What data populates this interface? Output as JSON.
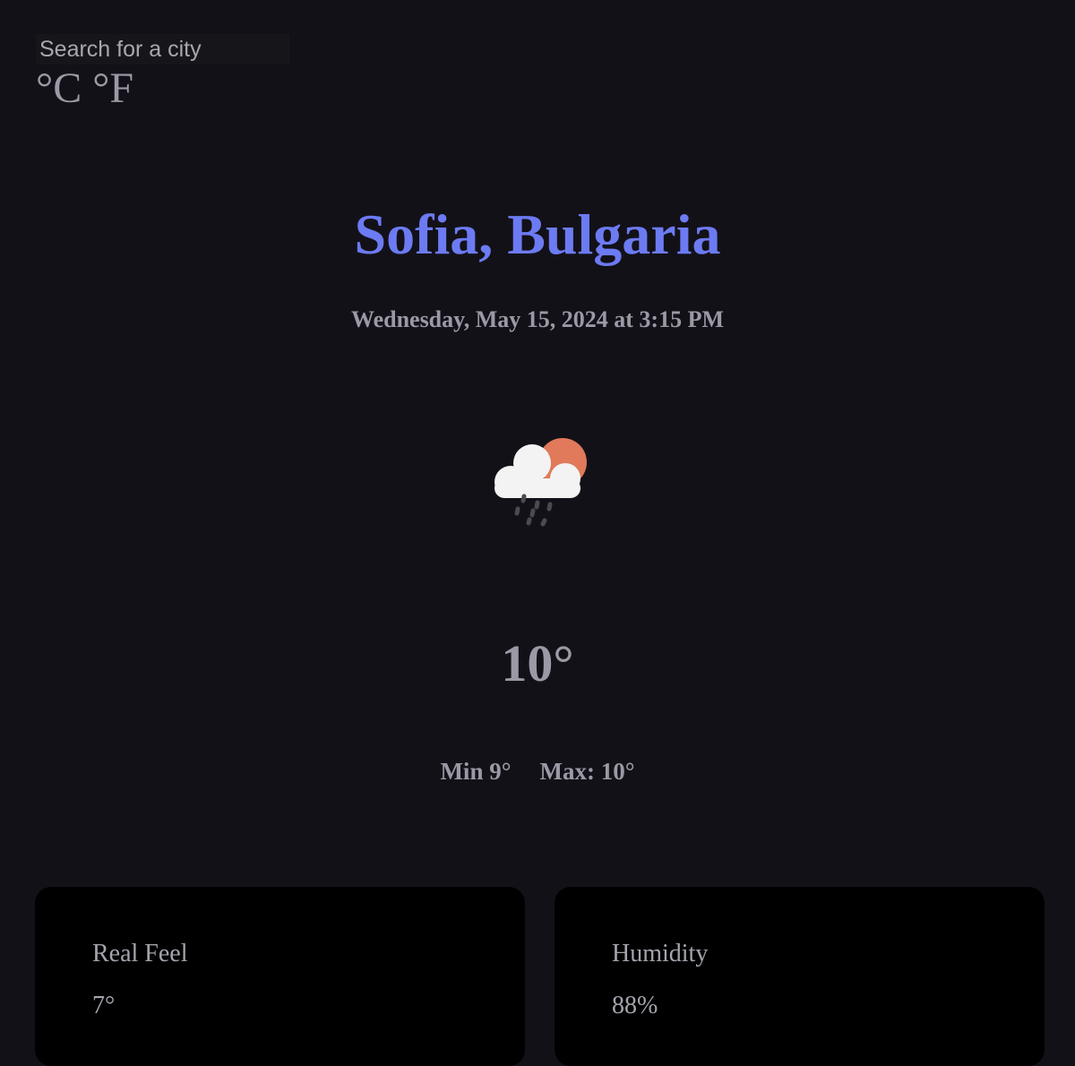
{
  "search": {
    "placeholder": "Search for a city",
    "value": ""
  },
  "units": {
    "celsius_label": "°C",
    "fahrenheit_label": "°F"
  },
  "location": {
    "title": "Sofia, Bulgaria"
  },
  "datetime": "Wednesday, May 15, 2024 at 3:15 PM",
  "weather": {
    "icon": "cloud-sun-rain-icon",
    "temperature": "10°",
    "min": "Min 9°",
    "max": "Max: 10°"
  },
  "cards": [
    {
      "label": "Real Feel",
      "value": "7°"
    },
    {
      "label": "Humidity",
      "value": "88%"
    }
  ],
  "colors": {
    "background": "#131118",
    "title": "#6c7bf2",
    "text": "#9a9aa6",
    "card": "#000000",
    "sun": "#e07a5a"
  }
}
